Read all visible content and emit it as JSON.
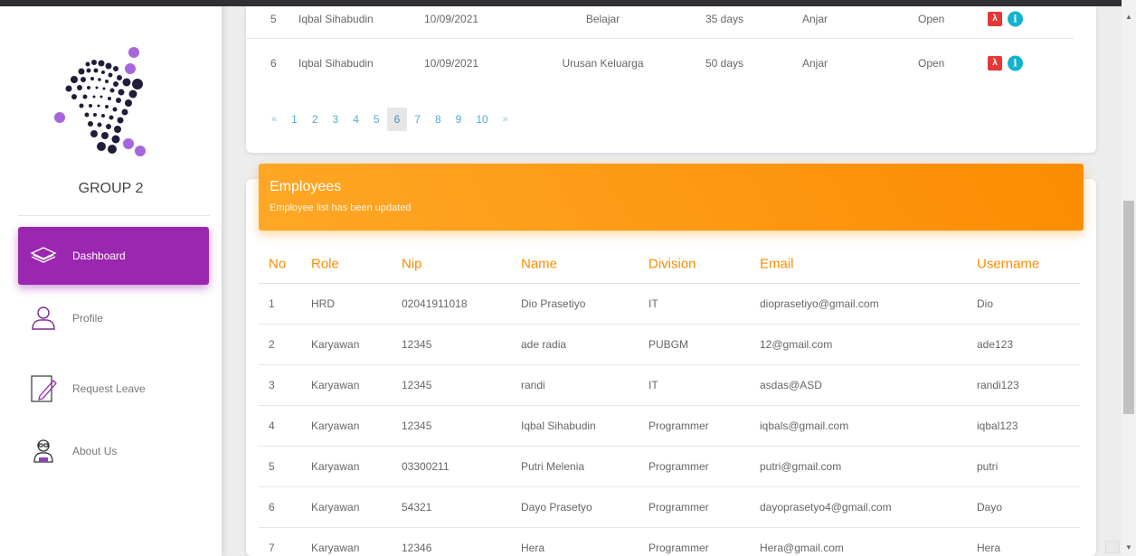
{
  "sidebar": {
    "group_name": "GROUP 2",
    "items": [
      {
        "label": "Dashboard",
        "icon": "layers-icon"
      },
      {
        "label": "Profile",
        "icon": "user-icon"
      },
      {
        "label": "Request Leave",
        "icon": "edit-icon"
      },
      {
        "label": "About Us",
        "icon": "team-icon"
      }
    ],
    "accent": "#9b27b0"
  },
  "leave": {
    "rows": [
      {
        "no": "5",
        "name": "Iqbal Sihabudin",
        "date": "10/09/2021",
        "reason": "Belajar",
        "days": "35 days",
        "by": "Anjar",
        "status": "Open"
      },
      {
        "no": "6",
        "name": "Iqbal Sihabudin",
        "date": "10/09/2021",
        "reason": "Urusan Keluarga",
        "days": "50 days",
        "by": "Anjar",
        "status": "Open"
      }
    ],
    "pagination": {
      "prev": "«",
      "next": "»",
      "pages": [
        "1",
        "2",
        "3",
        "4",
        "5",
        "6",
        "7",
        "8",
        "9",
        "10"
      ],
      "active": "6"
    }
  },
  "employees": {
    "title": "Employees",
    "subtitle": "Employee list has been updated",
    "header_color": "#fb8c00",
    "columns": [
      "No",
      "Role",
      "Nip",
      "Name",
      "Division",
      "Email",
      "Username"
    ],
    "rows": [
      {
        "no": "1",
        "role": "HRD",
        "nip": "02041911018",
        "name": "Dio Prasetiyo",
        "division": "IT",
        "email": "dioprasetiyo@gmail.com",
        "username": "Dio"
      },
      {
        "no": "2",
        "role": "Karyawan",
        "nip": "12345",
        "name": "ade radia",
        "division": "PUBGM",
        "email": "12@gmail.com",
        "username": "ade123"
      },
      {
        "no": "3",
        "role": "Karyawan",
        "nip": "12345",
        "name": "randi",
        "division": "IT",
        "email": "asdas@ASD",
        "username": "randi123"
      },
      {
        "no": "4",
        "role": "Karyawan",
        "nip": "12345",
        "name": "Iqbal Sihabudin",
        "division": "Programmer",
        "email": "iqbals@gmail.com",
        "username": "iqbal123"
      },
      {
        "no": "5",
        "role": "Karyawan",
        "nip": "03300211",
        "name": "Putri Melenia",
        "division": "Programmer",
        "email": "putri@gmail.com",
        "username": "putri"
      },
      {
        "no": "6",
        "role": "Karyawan",
        "nip": "54321",
        "name": "Dayo Prasetyo",
        "division": "Programmer",
        "email": "dayoprasetyo4@gmail.com",
        "username": "Dayo"
      },
      {
        "no": "7",
        "role": "Karyawan",
        "nip": "12346",
        "name": "Hera",
        "division": "Programmer",
        "email": "Hera@gmail.com",
        "username": "Hera"
      }
    ]
  }
}
